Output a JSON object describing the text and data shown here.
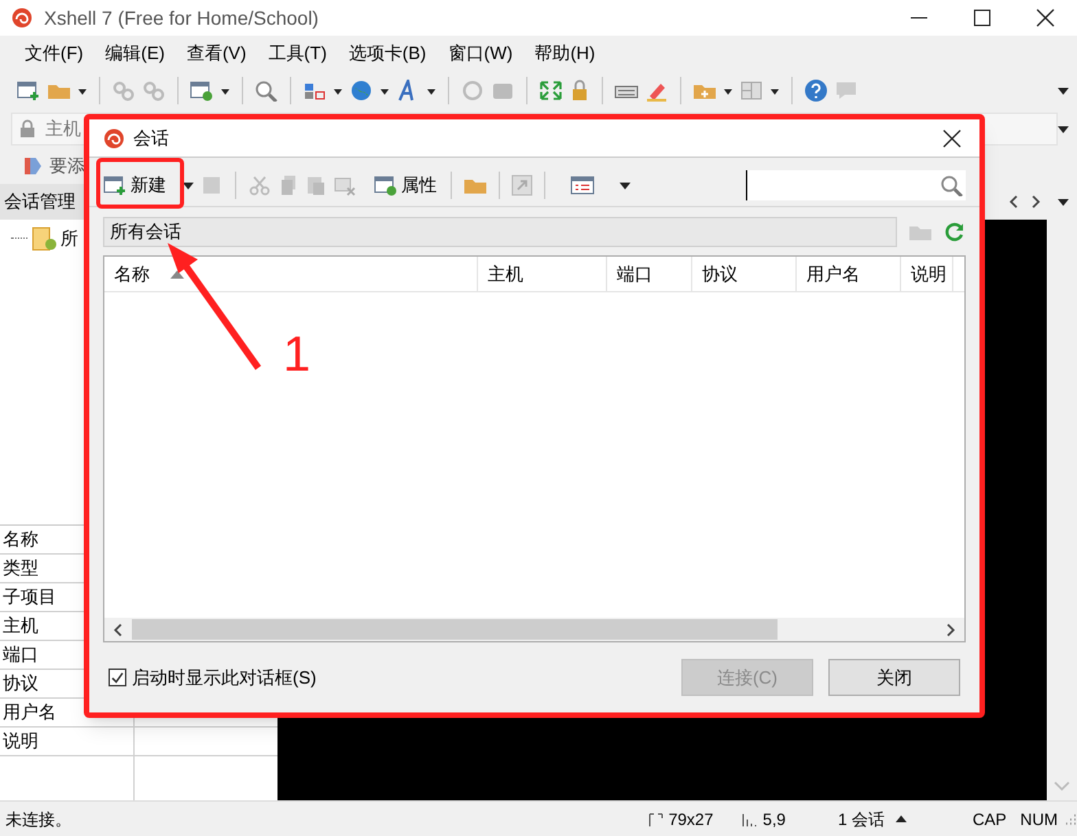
{
  "window": {
    "title": "Xshell 7 (Free for Home/School)"
  },
  "menu": [
    "文件(F)",
    "编辑(E)",
    "查看(V)",
    "工具(T)",
    "选项卡(B)",
    "窗口(W)",
    "帮助(H)"
  ],
  "address_bar": {
    "placeholder": "主机"
  },
  "links_bar": {
    "text": "要添"
  },
  "session_manager": {
    "title": "会话管理",
    "tree": [
      {
        "label": "所"
      }
    ],
    "properties": [
      "名称",
      "类型",
      "子项目",
      "主机",
      "端口",
      "协议",
      "用户名",
      "说明"
    ]
  },
  "dialog": {
    "title": "会话",
    "new_button": "新建",
    "properties_button": "属性",
    "path": "所有会话",
    "columns": [
      {
        "label": "名称",
        "sorted": true
      },
      {
        "label": "主机",
        "sorted": false
      },
      {
        "label": "端口",
        "sorted": false
      },
      {
        "label": "协议",
        "sorted": false
      },
      {
        "label": "用户名",
        "sorted": false
      },
      {
        "label": "说明",
        "sorted": false
      }
    ],
    "show_on_startup": {
      "label": "启动时显示此对话框(S)",
      "checked": true
    },
    "buttons": [
      {
        "label": "连接(C)",
        "disabled": true
      },
      {
        "label": "关闭",
        "disabled": false
      }
    ]
  },
  "annotation": {
    "label": "1"
  },
  "status_bar": {
    "text": "未连接。",
    "size": "79x27",
    "cursor": "5,9",
    "sessions": "1 会话",
    "caps": "CAP",
    "num": "NUM"
  }
}
